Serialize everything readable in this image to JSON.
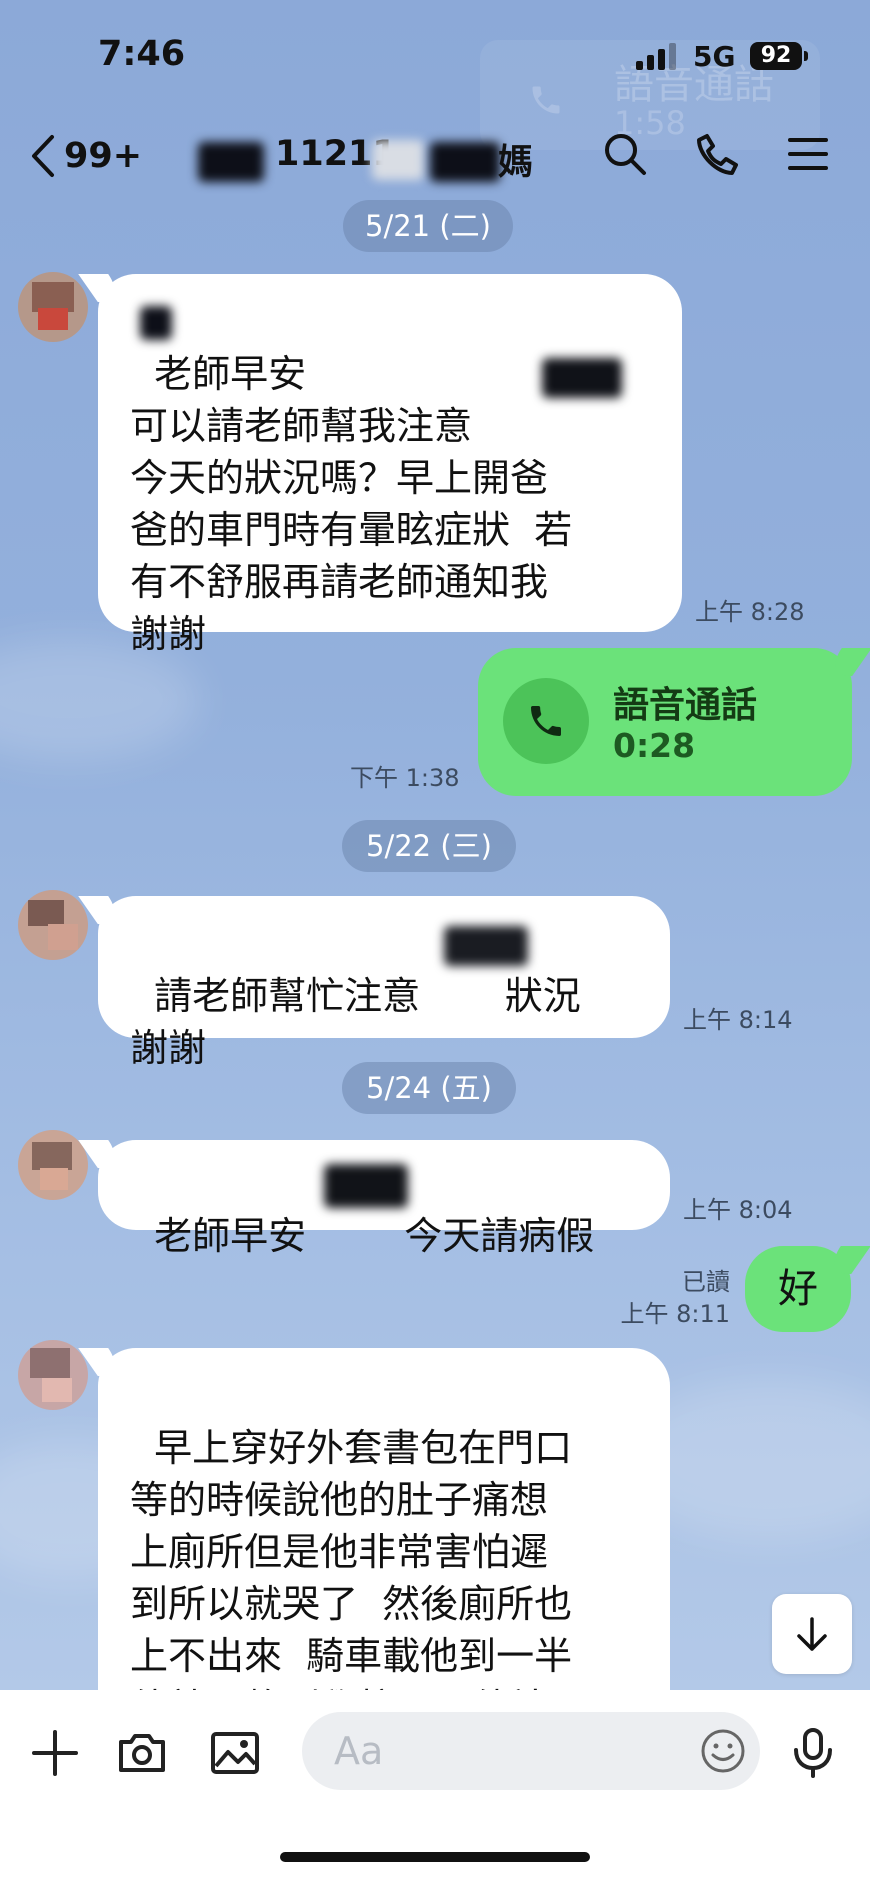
{
  "status_bar": {
    "time": "7:46",
    "network": "5G",
    "battery": "92"
  },
  "notification_ghost": {
    "title": "語音通話",
    "duration": "1:58"
  },
  "header": {
    "back_count": "99+",
    "chat_title": "11211",
    "chat_title_suffix": "媽",
    "icons": [
      "search-icon",
      "phone-icon",
      "menu-icon"
    ]
  },
  "messages": {
    "date1": "5/21 (二)",
    "m1_text": "老師早安\n可以請老師幫我注意\n今天的狀況嗎？早上開爸\n爸的車門時有暈眩症狀  若\n有不舒服再請老師通知我\n謝謝",
    "m1_time": "上午 8:28",
    "call_label": "語音通話",
    "call_duration": "0:28",
    "call_time": "下午 1:38",
    "date2": "5/22 (三)",
    "m2_text": "請老師幫忙注意       狀況\n謝謝",
    "m2_time": "上午 8:14",
    "date3": "5/24 (五)",
    "m3_text_a": "老師早安",
    "m3_text_b": "今天請病假",
    "m3_time": "上午 8:04",
    "out_read": "已讀",
    "out_time": "上午 8:11",
    "out_text": "好",
    "m4_text": "早上穿好外套書包在門口\n等的時候說他的肚子痛想\n上廁所但是他非常害怕遲\n到所以就哭了  然後廁所也\n上不出來  騎車載他到一半\n他就暈軟到學校門口他站"
  },
  "input": {
    "placeholder": "Aa"
  },
  "colors": {
    "chat_background": "#8fabd8",
    "outgoing_bubble": "#6be27a",
    "incoming_bubble": "#ffffff",
    "date_pill": "#7d94be"
  }
}
